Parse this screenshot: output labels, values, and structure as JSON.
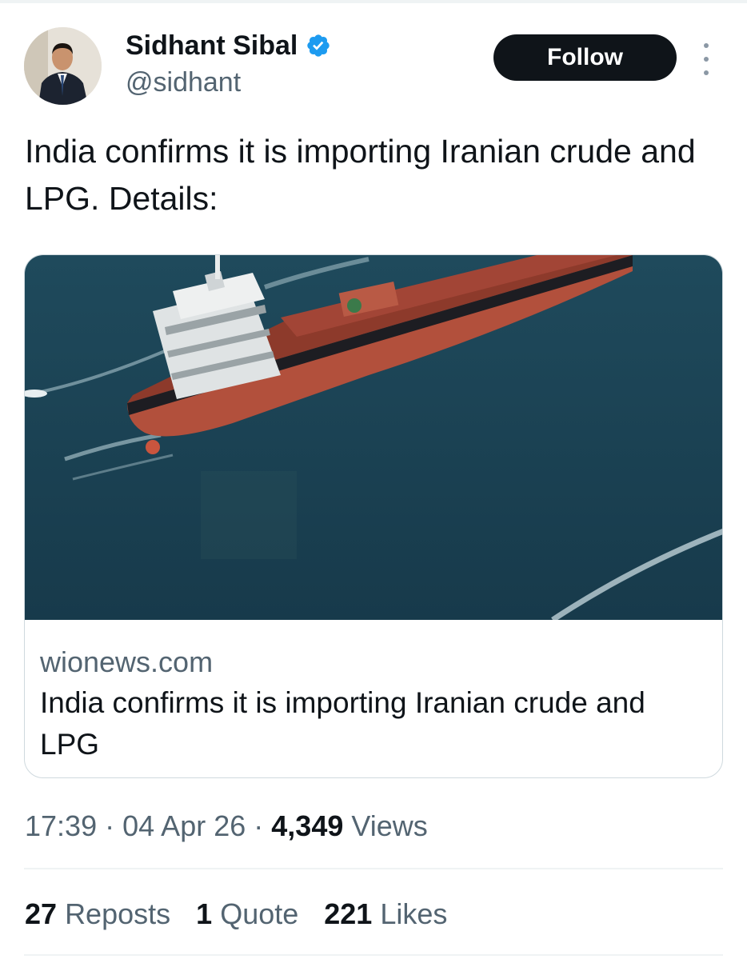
{
  "author": {
    "name": "Sidhant Sibal",
    "handle": "@sidhant",
    "verified": true,
    "verified_color": "#1d9bf0"
  },
  "follow_label": "Follow",
  "tweet": {
    "text": "India confirms it is importing Iranian crude and LPG. Details:"
  },
  "link_card": {
    "domain": "wionews.com",
    "title": "India confirms it is importing Iranian crude and LPG",
    "image": "aerial-photo-of-red-tanker-ship-at-sea"
  },
  "meta": {
    "time": "17:39",
    "date": "04 Apr 26",
    "separator": "·",
    "views_count": "4,349",
    "views_label": "Views"
  },
  "engagement": {
    "reposts_count": "27",
    "reposts_label": "Reposts",
    "quotes_count": "1",
    "quotes_label": "Quote",
    "likes_count": "221",
    "likes_label": "Likes"
  },
  "colors": {
    "text_primary": "#0f1419",
    "text_secondary": "#536471",
    "follow_button": "#0f1419",
    "border": "#cfd9de"
  }
}
